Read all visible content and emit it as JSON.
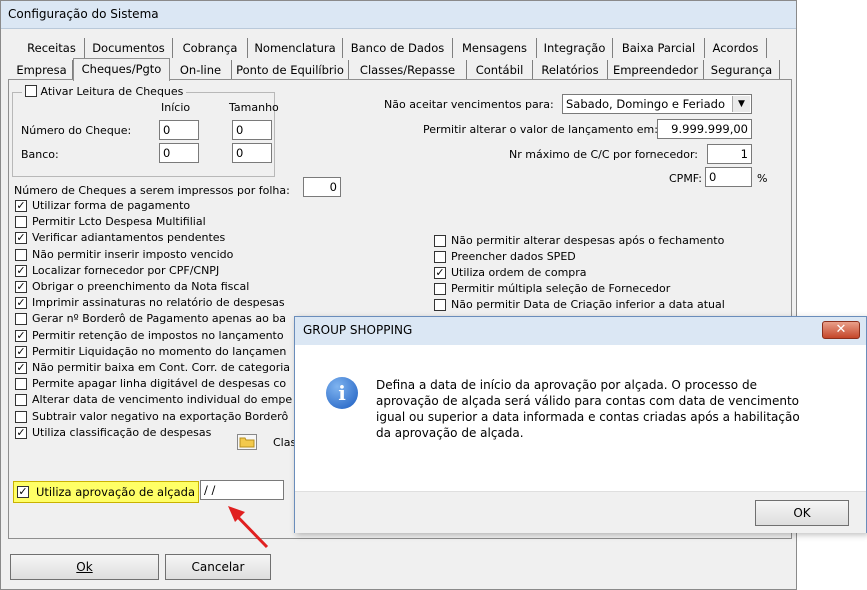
{
  "window": {
    "title": "Configuração do Sistema"
  },
  "tabs_row1": [
    "Receitas",
    "Documentos",
    "Cobrança",
    "Nomenclatura",
    "Banco de Dados",
    "Mensagens",
    "Integração",
    "Baixa Parcial",
    "Acordos"
  ],
  "tabs_row2": [
    "Empresa",
    "Cheques/Pgto",
    "On-line",
    "Ponto de Equilíbrio",
    "Classes/Repasse",
    "Contábil",
    "Relatórios",
    "Empreendedor",
    "Segurança"
  ],
  "active_tab": "Cheques/Pgto",
  "cheque_group": {
    "title": "Ativar Leitura de Cheques",
    "col_inicio": "Início",
    "col_tamanho": "Tamanho",
    "row_numero_label": "Número do Cheque:",
    "row_numero_inicio": "0",
    "row_numero_tamanho": "0",
    "row_banco_label": "Banco:",
    "row_banco_inicio": "0",
    "row_banco_tamanho": "0"
  },
  "right_fields": {
    "vencimento_label": "Não aceitar vencimentos para:",
    "vencimento_value": "Sabado, Domingo e Feriado",
    "alterar_label": "Permitir alterar o valor de lançamento em:",
    "alterar_value": "9.999.999,00",
    "nr_cc_label": "Nr máximo de C/C por fornecedor:",
    "nr_cc_value": "1",
    "cpmf_label": "CPMF:",
    "cpmf_value": "0",
    "cpmf_unit": "%"
  },
  "num_cheques": {
    "label": "Número de Cheques a serem impressos por folha:",
    "value": "0"
  },
  "left_checks": [
    {
      "label": "Utilizar forma de pagamento",
      "checked": true
    },
    {
      "label": "Permitir Lcto Despesa Multifilial",
      "checked": false
    },
    {
      "label": "Verificar adiantamentos pendentes",
      "checked": true
    },
    {
      "label": "Não permitir inserir imposto vencido",
      "checked": false
    },
    {
      "label": "Localizar fornecedor por CPF/CNPJ",
      "checked": true
    },
    {
      "label": "Obrigar o preenchimento da Nota fiscal",
      "checked": true
    },
    {
      "label": "Imprimir assinaturas no relatório de despesas",
      "checked": true
    },
    {
      "label": "Gerar nº Borderô de Pagamento apenas ao ba",
      "checked": false
    },
    {
      "label": "Permitir retenção de impostos no lançamento",
      "checked": true
    },
    {
      "label": "Permitir Liquidação no momento do lançamen",
      "checked": true
    },
    {
      "label": "Não permitir baixa em Cont. Corr. de categoria",
      "checked": true
    },
    {
      "label": "Permite apagar linha digitável de despesas co",
      "checked": false
    },
    {
      "label": "Alterar data de vencimento individual do empe",
      "checked": false
    },
    {
      "label": "Subtrair valor negativo na exportação Borderô",
      "checked": false
    },
    {
      "label": "Utiliza classificação de despesas",
      "checked": true
    }
  ],
  "classif_label": "Clas",
  "right_checks": [
    {
      "label": "Não permitir alterar despesas após o fechamento",
      "checked": false
    },
    {
      "label": "Preencher dados SPED",
      "checked": false
    },
    {
      "label": "Utiliza ordem de compra",
      "checked": true
    },
    {
      "label": "Permitir múltipla seleção de Fornecedor",
      "checked": false
    },
    {
      "label": "Não permitir Data de Criação inferior a data atual",
      "checked": false
    }
  ],
  "alcada": {
    "label": "Utiliza aprovação de alçada",
    "checked": true,
    "date_value": " / /"
  },
  "buttons": {
    "ok": "Ok",
    "cancel": "Cancelar"
  },
  "dialog": {
    "title": "GROUP SHOPPING",
    "close": "✕",
    "message_lines": [
      "Defina a data de início da aprovação por alçada. O processo de",
      "aprovação de alçada será válido para contas com data de vencimento",
      "igual ou superior a data informada e contas criadas após a habilitação",
      "da aprovação de alçada."
    ],
    "ok": "OK"
  },
  "colors": {
    "highlight": "#ffff66",
    "arrow": "#e02020",
    "title_bg": "#dbe7f4",
    "info_icon": "#1b5cc0"
  },
  "icons": [
    "folder-icon",
    "info-icon",
    "dropdown-arrow-icon",
    "close-icon",
    "red-arrow-annotation"
  ]
}
